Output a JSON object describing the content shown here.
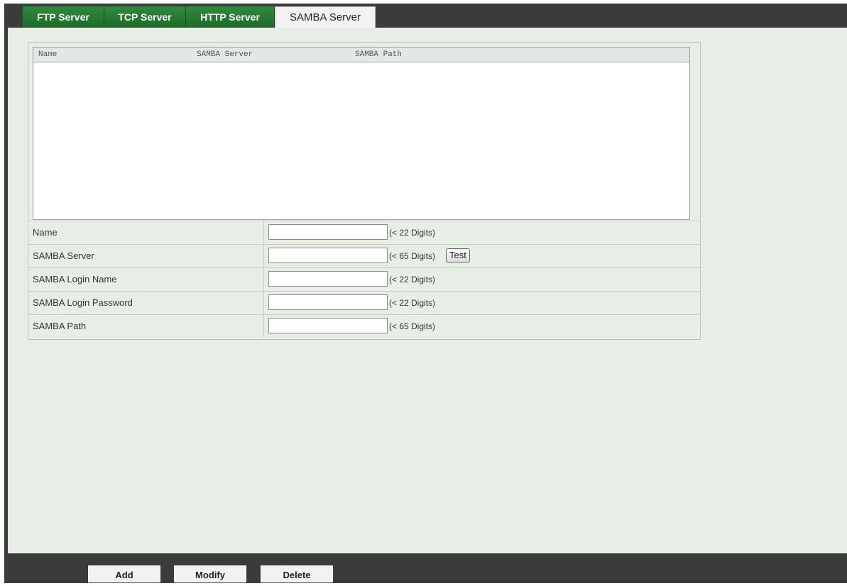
{
  "tabs": [
    {
      "label": "FTP Server",
      "active": false
    },
    {
      "label": "TCP Server",
      "active": false
    },
    {
      "label": "HTTP Server",
      "active": false
    },
    {
      "label": "SAMBA Server",
      "active": true
    }
  ],
  "list": {
    "columns": [
      "Name",
      "SAMBA Server",
      "SAMBA Path"
    ],
    "rows": []
  },
  "form": {
    "fields": [
      {
        "label": "Name",
        "value": "",
        "hint": "(< 22 Digits)"
      },
      {
        "label": "SAMBA Server",
        "value": "",
        "hint": "(< 65 Digits)"
      },
      {
        "label": "SAMBA Login Name",
        "value": "",
        "hint": "(< 22 Digits)"
      },
      {
        "label": "SAMBA Login Password",
        "value": "",
        "hint": "(< 22 Digits)"
      },
      {
        "label": "SAMBA Path",
        "value": "",
        "hint": "(< 65 Digits)"
      }
    ],
    "test_label": "Test"
  },
  "buttons": {
    "add": "Add",
    "modify": "Modify",
    "delete": "Delete"
  },
  "colors": {
    "tab_green": "#2f8a3c",
    "content_bg": "#e6eee6",
    "frame_dark": "#3b3b3b"
  }
}
